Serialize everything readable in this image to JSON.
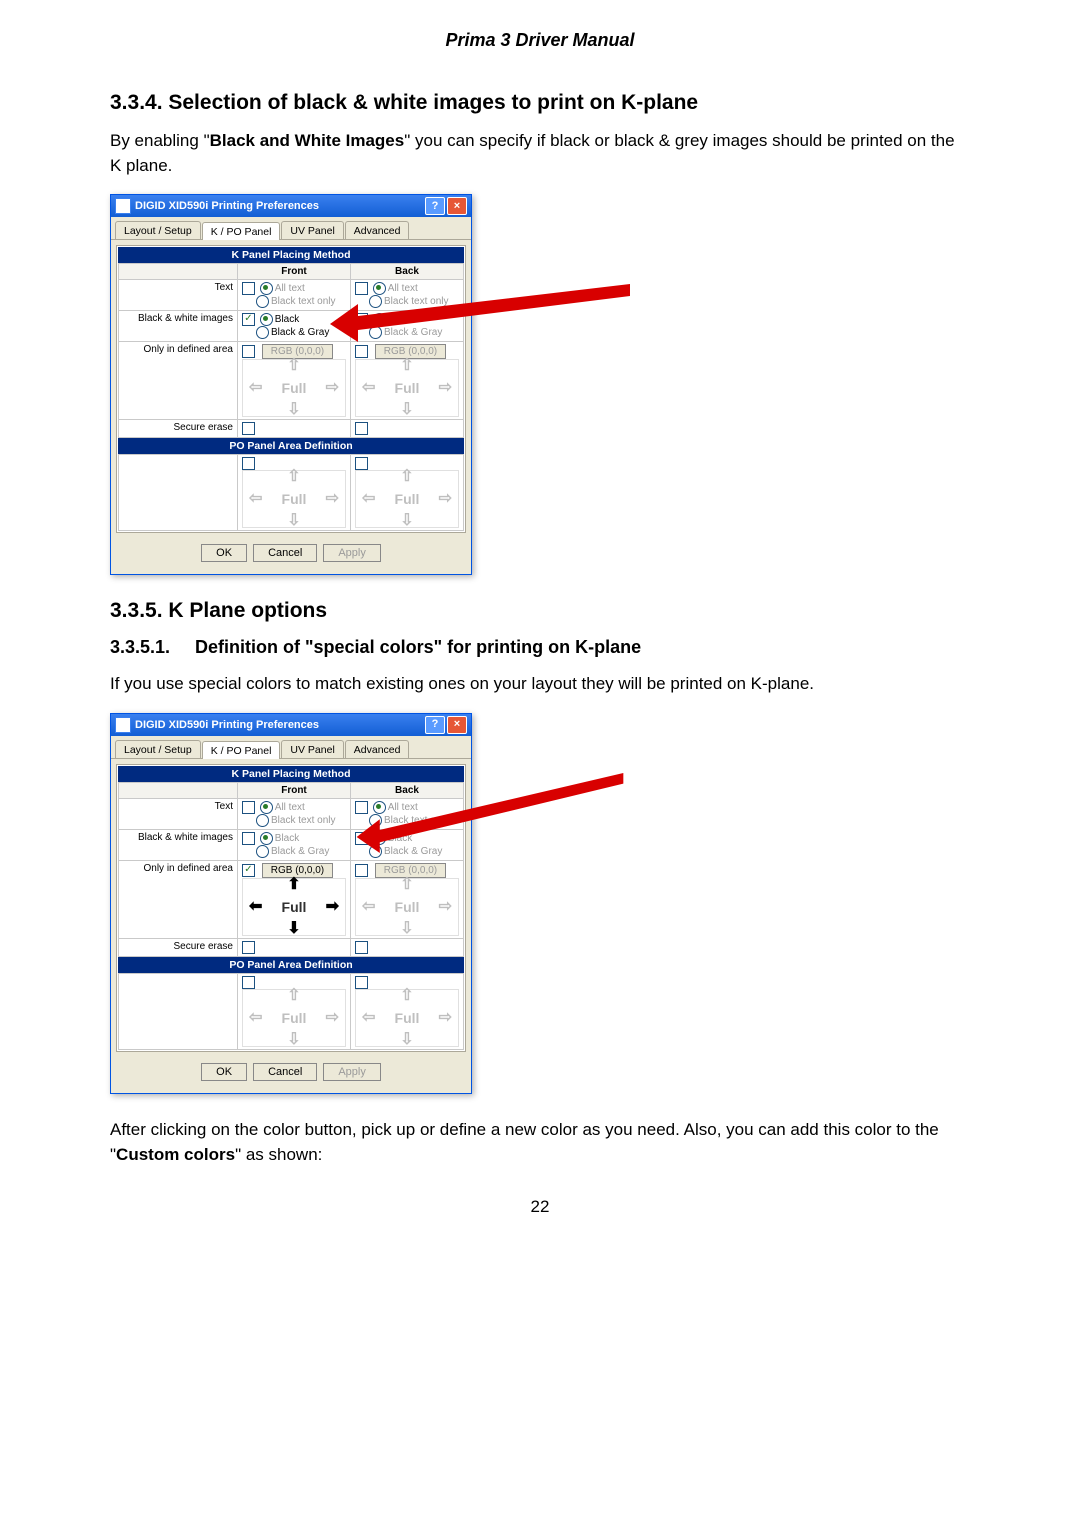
{
  "doc": {
    "header": "Prima 3 Driver Manual",
    "page_number": "22",
    "h_334": "3.3.4. Selection of black & white images to print on K-plane",
    "p_334a": "By enabling \"",
    "p_334b": "Black and White Images",
    "p_334c": "\" you can specify if black or black & grey images should be printed on the K plane.",
    "h_335": "3.3.5. K Plane options",
    "h_3351_num": "3.3.5.1.",
    "h_3351_txt": "Definition of \"special colors\" for printing on K-plane",
    "p_3351": "If you use special colors to match existing ones on your layout they will be printed on K-plane.",
    "p_aftera": "After clicking on the color button, pick up or define a new color as you need. Also, you can add this color to the \"",
    "p_afterb": "Custom colors",
    "p_afterc": "\" as shown:"
  },
  "dialog": {
    "title": "DIGID XID590i Printing Preferences",
    "tabs": [
      "Layout / Setup",
      "K / PO Panel",
      "UV Panel",
      "Advanced"
    ],
    "selected_tab": "K / PO Panel",
    "section1_title": "K Panel Placing Method",
    "col_front": "Front",
    "col_back": "Back",
    "row_text": "Text",
    "opt_alltext": "All text",
    "opt_blacktextonly": "Black text only",
    "row_bwimages": "Black & white images",
    "opt_black": "Black",
    "opt_blackgray": "Black & Gray",
    "row_defined": "Only in defined area",
    "rgb_label": "RGB (0,0,0)",
    "full_label": "Full",
    "row_secure": "Secure erase",
    "section2_title": "PO Panel Area Definition",
    "btn_ok": "OK",
    "btn_cancel": "Cancel",
    "btn_apply": "Apply"
  }
}
